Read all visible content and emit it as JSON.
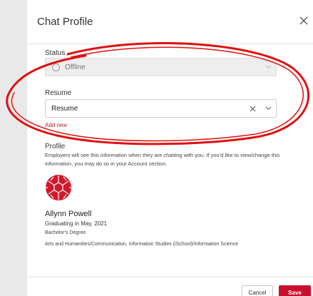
{
  "dialog": {
    "title": "Chat Profile",
    "close_icon": "close-icon"
  },
  "status": {
    "label": "Status",
    "value": "Offline",
    "disabled": true
  },
  "resume": {
    "label": "Resume",
    "value": "Resume",
    "add_new": "Add new"
  },
  "profile": {
    "label": "Profile",
    "description": "Employers will see this information when they are chatting with you. If you'd like to view/change this information, you may do so in your Account section.",
    "avatar_icon": "school-logo-icon",
    "name": "Allynn Powell",
    "graduation": "Graduating in May, 2021",
    "degree": "Bachelor's Degree",
    "major": "Arts and Humanities/Communication, Information Studies (iSchool)/Information Science"
  },
  "footer": {
    "cancel_label": "Cancel",
    "save_label": "Save"
  },
  "colors": {
    "accent": "#c8102e",
    "annotation": "#e01010",
    "link": "#b5222c"
  }
}
